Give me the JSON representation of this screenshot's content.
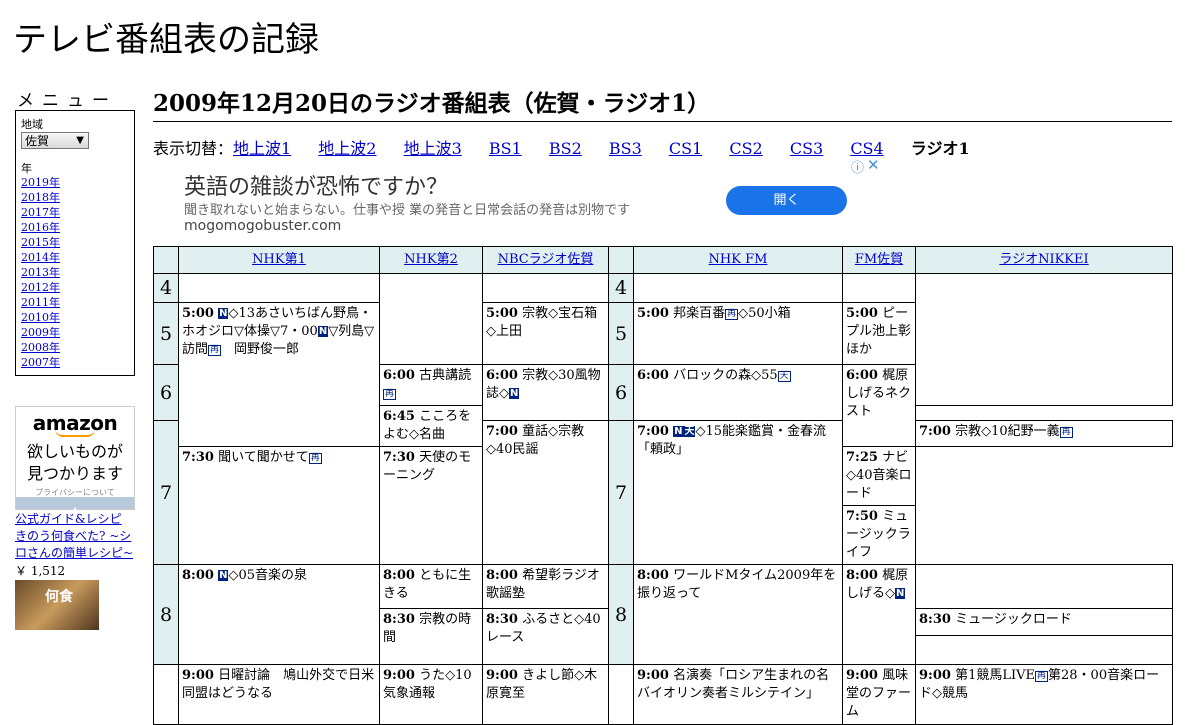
{
  "site": {
    "title": "テレビ番組表の記録"
  },
  "sidebar": {
    "menu_title": "メニュー",
    "region_label": "地域",
    "region_value": "佐賀",
    "year_label": "年",
    "years": [
      "2019年",
      "2018年",
      "2017年",
      "2016年",
      "2015年",
      "2014年",
      "2013年",
      "2012年",
      "2011年",
      "2010年",
      "2009年",
      "2008年",
      "2007年"
    ]
  },
  "amazon_ad": {
    "logo": "amazon",
    "text1": "欲しいものが",
    "text2": "見つかります",
    "privacy": "プライバシーについて",
    "book_link": "公式ガイド&レシピ きのう何食べた? ~シロさんの簡単レシピ~",
    "price": "￥ 1,512",
    "cover_text": "何食"
  },
  "page": {
    "title": "2009年12月20日のラジオ番組表（佐賀・ラジオ1）",
    "switch_label": "表示切替：",
    "tabs": [
      "地上波1",
      "地上波2",
      "地上波3",
      "BS1",
      "BS2",
      "BS3",
      "CS1",
      "CS2",
      "CS3",
      "CS4"
    ],
    "current_tab": "ラジオ1"
  },
  "banner_ad": {
    "headline": "英語の雑談が恐怖ですか？",
    "body": "聞き取れないと始まらない。仕事や授 業の発音と日常会話の発音は別物です",
    "domain": "mogomogobuster.com",
    "button": "開く",
    "info_icon": "ⓘ",
    "close_icon": "✕"
  },
  "schedule": {
    "channels": [
      "NHK第1",
      "NHK第2",
      "NBCラジオ佐賀",
      "NHK FM",
      "FM佐賀",
      "ラジオNIKKEI"
    ],
    "hours": [
      "4",
      "5",
      "6",
      "7",
      "8"
    ],
    "badges": {
      "news": "N",
      "rerun": "再",
      "weather": "天"
    },
    "programs": {
      "nhk1_5": {
        "time": "5:00",
        "pre": "",
        "text": "◇13あさいちばん野鳥・ホオジロ▽体操▽7・00",
        "text2": "▽列島▽訪問",
        "text3": "　岡野俊一郎"
      },
      "nhk1_8": {
        "time": "8:00",
        "text": "◇05音楽の泉"
      },
      "nhk1_9": {
        "time": "9:00",
        "text": "日曜討論　鳩山外交で日米同盟はどうなる"
      },
      "nhk2_6": {
        "time": "6:00",
        "text": "古典講読"
      },
      "nhk2_645": {
        "time": "6:45",
        "text": "こころをよむ◇名曲"
      },
      "nhk2_730": {
        "time": "7:30",
        "text": "聞いて聞かせて"
      },
      "nhk2_8": {
        "time": "8:00",
        "text": "ともに生きる"
      },
      "nhk2_830": {
        "time": "8:30",
        "text": "宗教の時間"
      },
      "nhk2_9": {
        "time": "9:00",
        "text": "うた◇10気象通報"
      },
      "nbc_5": {
        "time": "5:00",
        "text": "宗教◇宝石箱◇上田"
      },
      "nbc_6": {
        "time": "6:00",
        "text": "宗教◇30風物誌◇"
      },
      "nbc_7": {
        "time": "7:00",
        "text": "童話◇宗教◇40民謡"
      },
      "nbc_8": {
        "time": "8:00",
        "text": "希望彰ラジオ歌謡塾"
      },
      "nbc_830": {
        "time": "8:30",
        "text": "ふるさと◇40レース"
      },
      "nbc_9": {
        "time": "9:00",
        "text": "きよし節◇木原寛至"
      },
      "fm_5": {
        "time": "5:00",
        "text": "邦楽百番",
        "text2": "◇50小箱"
      },
      "fm_6": {
        "time": "6:00",
        "text": "バロックの森◇55"
      },
      "fm_7": {
        "time": "7:00",
        "text": "◇15能楽鑑賞・金春流「頼政」"
      },
      "fm_8": {
        "time": "8:00",
        "text": "ワールドMタイム2009年を振り返って"
      },
      "fm_9": {
        "time": "9:00",
        "text": "名演奏「ロシア生まれの名バイオリン奏者ミルシテイン」"
      },
      "fms_5": {
        "time": "5:00",
        "text": "ピープル池上彰ほか"
      },
      "fms_6": {
        "time": "6:00",
        "text": "梶原しげるネクスト"
      },
      "fms_730": {
        "time": "7:30",
        "text": "天使のモーニング"
      },
      "fms_8": {
        "time": "8:00",
        "text": "梶原しげる◇"
      },
      "fms_9": {
        "time": "9:00",
        "text": "風味堂のファーム"
      },
      "nik_7": {
        "time": "7:00",
        "text": "宗教◇10紀野一義"
      },
      "nik_725": {
        "time": "7:25",
        "text": "ナビ◇40音楽ロード"
      },
      "nik_750": {
        "time": "7:50",
        "text": "ミュージックライフ"
      },
      "nik_830": {
        "time": "8:30",
        "text": "ミュージックロード"
      },
      "nik_9": {
        "time": "9:00",
        "text": "第1競馬LIVE",
        "text2": "第28・00音楽ロード◇競馬"
      }
    }
  }
}
